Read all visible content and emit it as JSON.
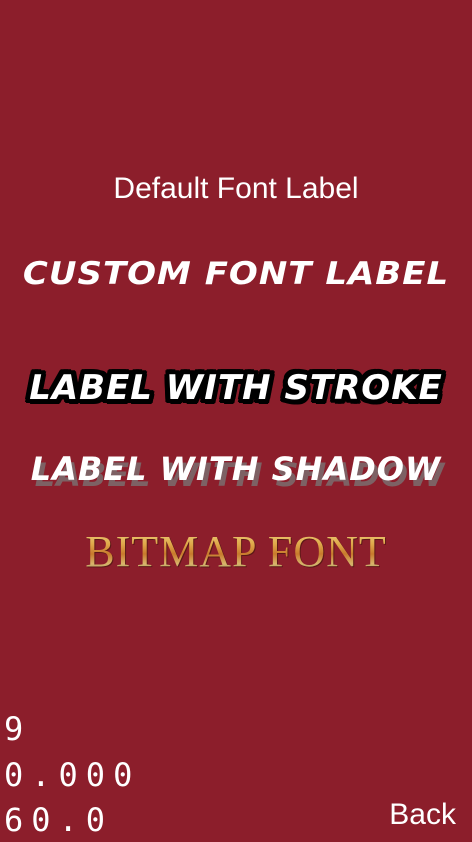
{
  "labels": {
    "default_font": "Default Font Label",
    "custom_font": "CUSTOM FONT LABEL",
    "with_stroke": "LABEL WITH STROKE",
    "with_shadow": "LABEL WITH SHADOW",
    "bitmap_font": "BITMAP FONT"
  },
  "stats": {
    "draw_calls": "9",
    "frame_time": "0.000",
    "fps": "60.0"
  },
  "navigation": {
    "back_label": "Back"
  },
  "colors": {
    "background": "#8c1e2b",
    "text": "#ffffff",
    "stroke": "#000000",
    "shadow": "#787878",
    "bitmap_gold": "#e0a84a"
  }
}
